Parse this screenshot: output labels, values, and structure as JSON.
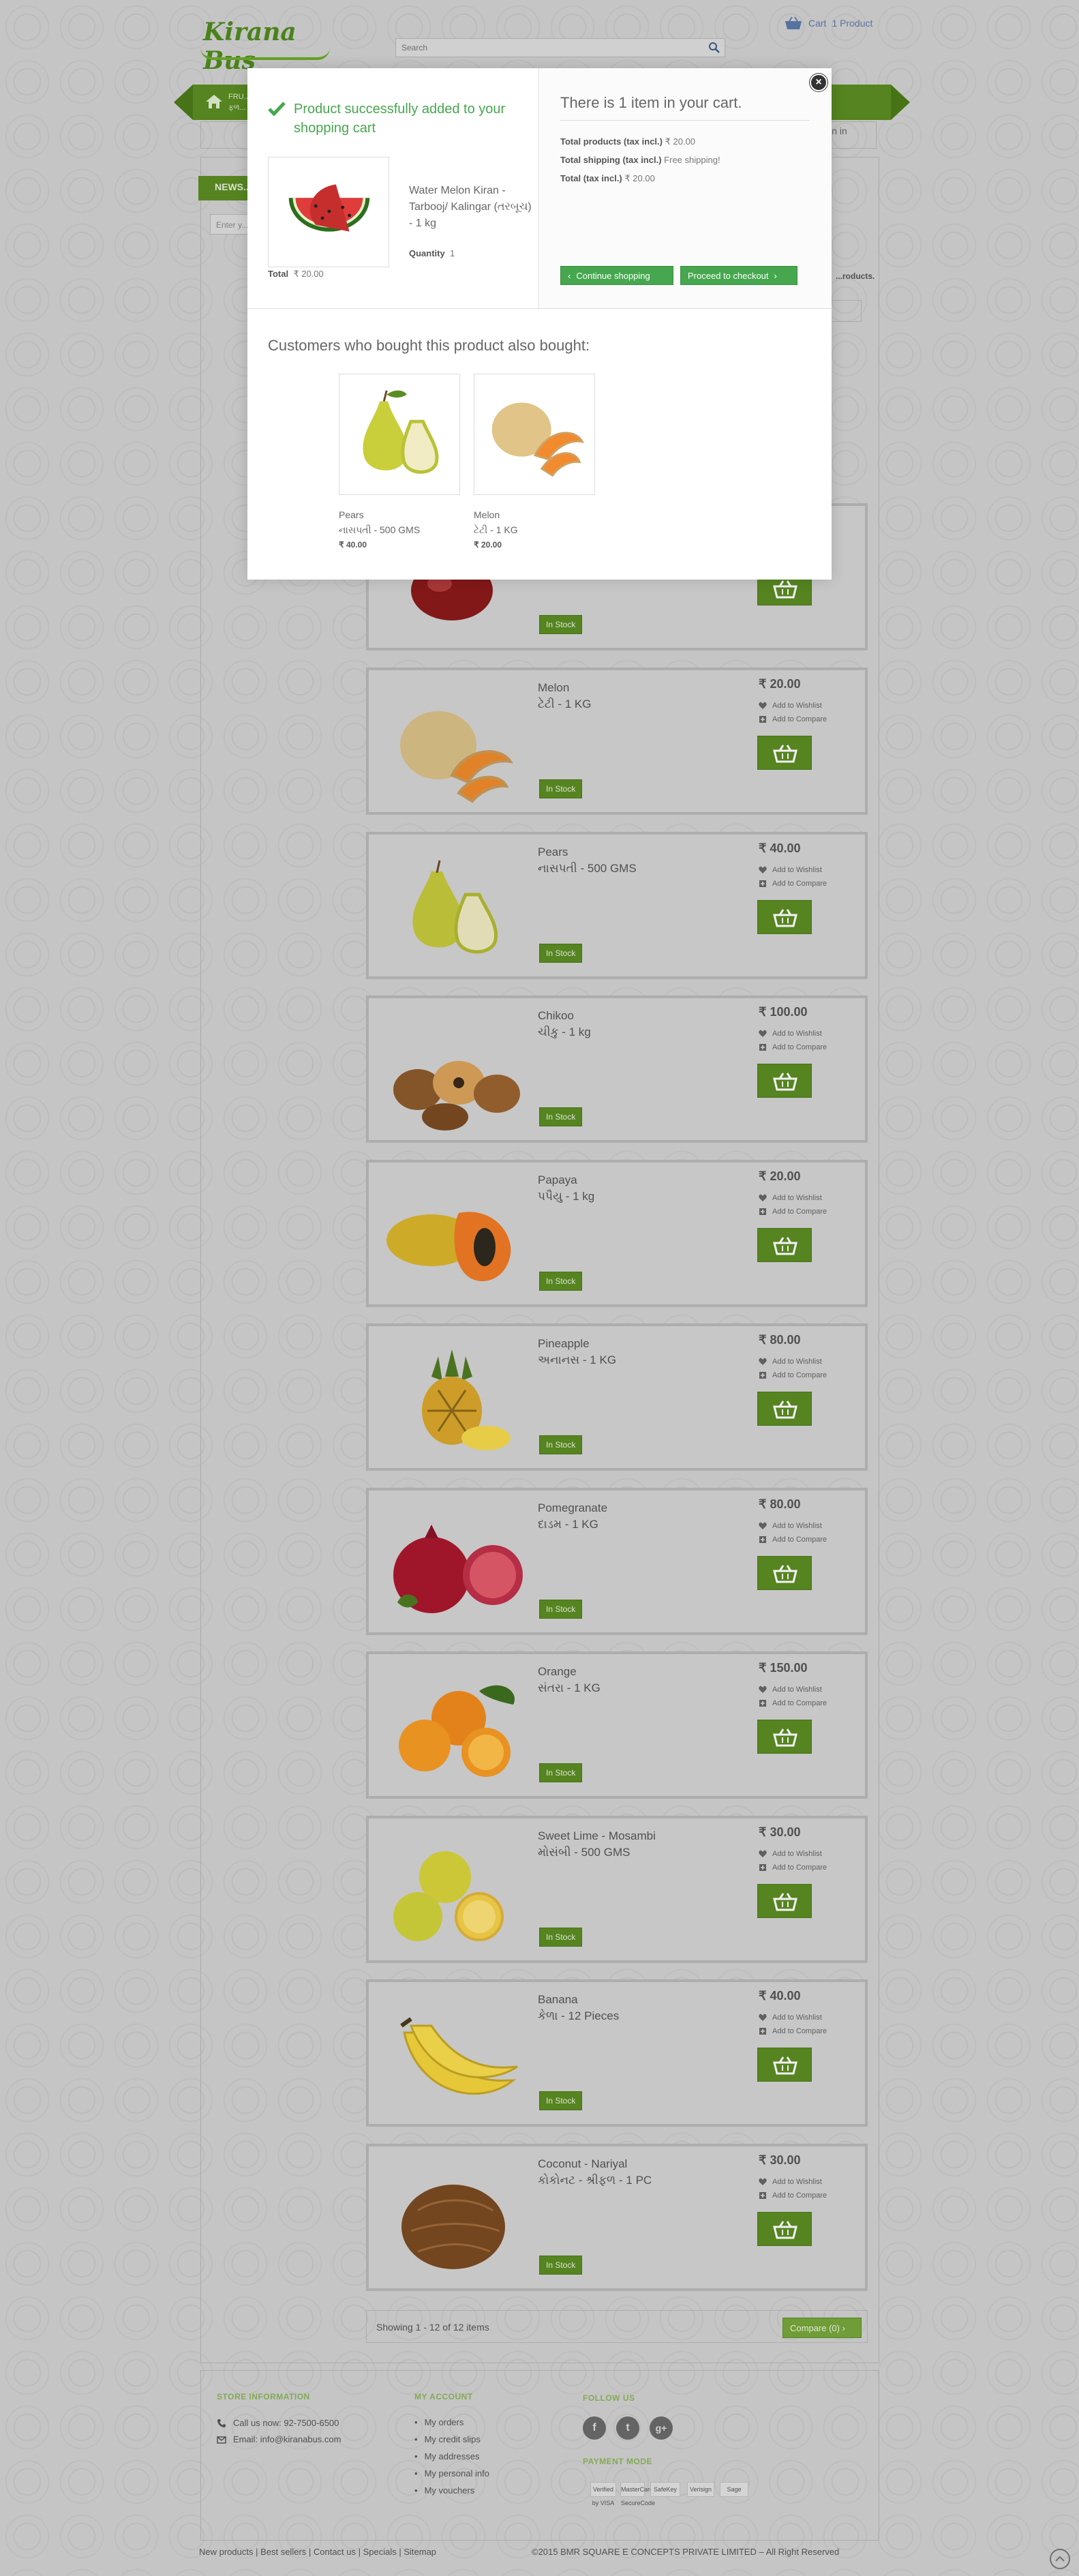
{
  "header": {
    "logo_text": "Kirana Bus",
    "search_placeholder": "Search",
    "cart_label": "Cart",
    "cart_count": "1 Product",
    "nav_item": "FRU...",
    "nav_item_sub": "ફળ...",
    "signin": "Sign in"
  },
  "sidebar": {
    "newsletter": "NEWS...",
    "newsletter_placeholder": "Enter y..."
  },
  "listing": {
    "products_count": "...roducts.",
    "showing": "Showing 1 - 12 of 12 items",
    "compare_button": "Compare (0)",
    "wishlist_label": "Add to Wishlist",
    "compare_label": "Add to Compare",
    "in_stock": "In Stock",
    "products": [
      {
        "name": "Melon",
        "sub": "ટેટી - 1 KG",
        "price": "₹ 20.00",
        "img": "melon"
      },
      {
        "name": "Pears",
        "sub": "નાસપતી - 500 GMS",
        "price": "₹ 40.00",
        "img": "pears"
      },
      {
        "name": "Chikoo",
        "sub": "ચીકુ - 1 kg",
        "price": "₹ 100.00",
        "img": "chikoo"
      },
      {
        "name": "Papaya",
        "sub": "પપૈયુ - 1 kg",
        "price": "₹ 20.00",
        "img": "papaya"
      },
      {
        "name": "Pineapple",
        "sub": "અનાનસ - 1 KG",
        "price": "₹ 80.00",
        "img": "pineapple"
      },
      {
        "name": "Pomegranate",
        "sub": "દાડમ - 1 KG",
        "price": "₹ 80.00",
        "img": "pomegranate"
      },
      {
        "name": "Orange",
        "sub": "સંતરા - 1 KG",
        "price": "₹ 150.00",
        "img": "orange"
      },
      {
        "name": "Sweet Lime - Mosambi",
        "sub": "મોસંબી - 500 GMS",
        "price": "₹ 30.00",
        "img": "sweetlime"
      },
      {
        "name": "Banana",
        "sub": "કેળા - 12 Pieces",
        "price": "₹ 40.00",
        "img": "banana"
      },
      {
        "name": "Coconut - Nariyal",
        "sub": "કોકોનટ - શ્રીફળ - 1 PC",
        "price": "₹ 30.00",
        "img": "coconut"
      }
    ]
  },
  "footer": {
    "store_title": "STORE INFORMATION",
    "call": "Call us now: 92-7500-6500",
    "email": "Email: info@kiranabus.com",
    "account_title": "MY ACCOUNT",
    "account_links": [
      "My orders",
      "My credit slips",
      "My addresses",
      "My personal info",
      "My vouchers"
    ],
    "follow_title": "FOLLOW US",
    "payment_title": "PAYMENT MODE",
    "payment_logos": [
      "Verified by VISA",
      "MasterCard SecureCode",
      "SafeKey",
      "Verisign",
      "Sage"
    ],
    "bottom_links": "New products  |  Best sellers  |  Contact us  |  Specials  |  Sitemap",
    "copyright": "©2015 BMR SQUARE E CONCEPTS PRIVATE LIMITED – All Right Reserved"
  },
  "modal": {
    "success": "Product successfully added to your shopping cart",
    "product_name": "Water Melon Kiran - Tarbooj/ Kalingar (તરબૂચ) - 1 kg",
    "quantity_label": "Quantity",
    "quantity": "1",
    "total_label": "Total",
    "total": "₹ 20.00",
    "cart_count": "There is 1 item in your cart.",
    "total_products_label": "Total products (tax incl.)",
    "total_products": "₹ 20.00",
    "total_shipping_label": "Total shipping (tax incl.)",
    "total_shipping": "Free shipping!",
    "total_tax_label": "Total (tax incl.)",
    "total_tax": "₹ 20.00",
    "continue": "Continue shopping",
    "checkout": "Proceed to checkout",
    "also_title": "Customers who bought this product also bought:",
    "also": [
      {
        "name": "Pears",
        "sub": "નાસપતી - 500 GMS",
        "price": "₹ 40.00"
      },
      {
        "name": "Melon",
        "sub": "ટેટી - 1 KG",
        "price": "₹ 20.00"
      }
    ]
  },
  "colors": {
    "brand_green": "#5a8c22",
    "success_green": "#46a74e"
  }
}
